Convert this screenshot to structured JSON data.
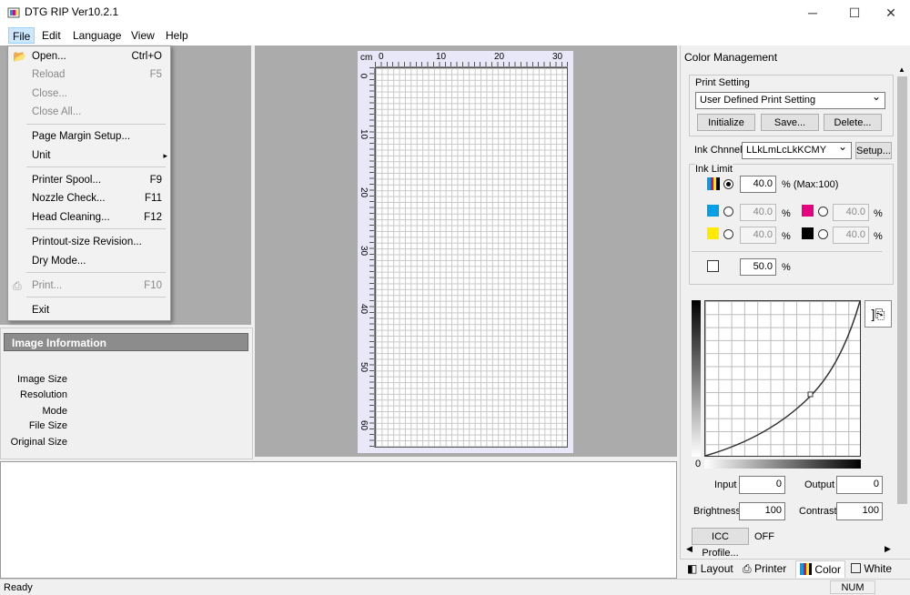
{
  "window": {
    "title": "DTG RIP Ver10.2.1",
    "min": "─",
    "max": "☐",
    "close": "✕"
  },
  "menubar": [
    "File",
    "Edit",
    "Language",
    "View",
    "Help"
  ],
  "file_menu": [
    {
      "label": "Open...",
      "shortcut": "Ctrl+O",
      "enabled": true
    },
    {
      "label": "Reload",
      "shortcut": "F5",
      "enabled": false
    },
    {
      "label": "Close...",
      "shortcut": "",
      "enabled": false
    },
    {
      "label": "Close All...",
      "shortcut": "",
      "enabled": false
    },
    {
      "label": "Page Margin Setup...",
      "shortcut": "",
      "enabled": true
    },
    {
      "label": "Unit",
      "shortcut": "▸",
      "enabled": true
    },
    {
      "label": "Printer Spool...",
      "shortcut": "F9",
      "enabled": true
    },
    {
      "label": "Nozzle Check...",
      "shortcut": "F11",
      "enabled": true
    },
    {
      "label": "Head Cleaning...",
      "shortcut": "F12",
      "enabled": true
    },
    {
      "label": "Printout-size Revision...",
      "shortcut": "",
      "enabled": true
    },
    {
      "label": "Dry Mode...",
      "shortcut": "",
      "enabled": true
    },
    {
      "label": "Print...",
      "shortcut": "F10",
      "enabled": false
    },
    {
      "label": "Exit",
      "shortcut": "",
      "enabled": true
    }
  ],
  "ruler": {
    "unit": "cm",
    "h": [
      "0",
      "10",
      "20",
      "30"
    ],
    "v": [
      "0",
      "10",
      "20",
      "30",
      "40",
      "50",
      "60"
    ]
  },
  "info": {
    "title": "Image Information",
    "labels": [
      "Image Size",
      "Resolution",
      "Mode",
      "File Size",
      "Original Size"
    ]
  },
  "status": {
    "left": "Ready",
    "right": "NUM"
  },
  "color": {
    "title": "Color Management",
    "print_setting_label": "Print Setting",
    "print_setting_value": "User Defined Print Setting",
    "btn_init": "Initialize",
    "btn_save": "Save...",
    "btn_delete": "Delete...",
    "ink_channel_label": "Ink Chnnel",
    "ink_channel_value": "LLkLmLcLkKCMY",
    "btn_setup": "Setup...",
    "ink_limit_label": "Ink Limit",
    "total_value": "40.0",
    "total_unit": "% (Max:100)",
    "c_value": "40.0",
    "m_value": "40.0",
    "y_value": "40.0",
    "k_value": "40.0",
    "pct": "%",
    "white_value": "50.0",
    "curve_zero": "0",
    "input_label": "Input",
    "input_value": "0",
    "output_label": "Output",
    "output_value": "0",
    "brightness_label": "Brightness",
    "brightness_value": "100",
    "contrast_label": "Contrast",
    "contrast_value": "100",
    "icc_button": "ICC Profile...",
    "icc_state": "OFF",
    "colors": {
      "cyan": "#00a0e8",
      "magenta": "#e4007f",
      "yellow": "#ffea00",
      "black": "#000000"
    }
  },
  "tabs": [
    "Layout",
    "Printer",
    "Color",
    "White"
  ]
}
